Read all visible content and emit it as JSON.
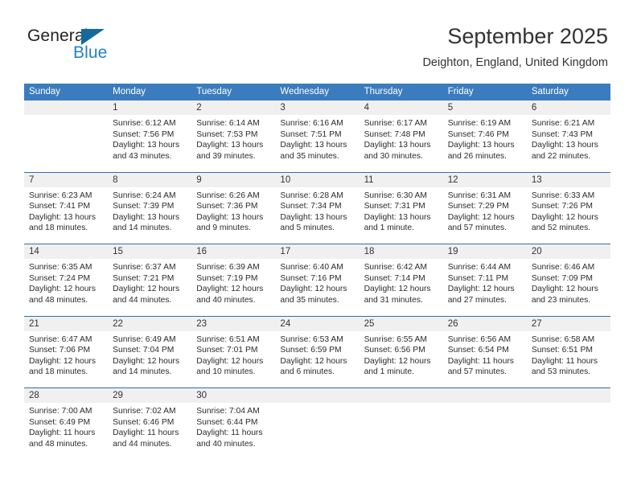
{
  "brand": {
    "line1": "General",
    "line2": "Blue",
    "triangle_color": "#15699e",
    "blue_text_color": "#2481c4"
  },
  "header": {
    "title": "September 2025",
    "subtitle": "Deighton, England, United Kingdom"
  },
  "theme": {
    "header_blue": "#3a7cbe",
    "row_divider_blue": "#2f6fae",
    "date_band_gray": "#f0f0f0"
  },
  "weekdays": [
    "Sunday",
    "Monday",
    "Tuesday",
    "Wednesday",
    "Thursday",
    "Friday",
    "Saturday"
  ],
  "weeks": [
    [
      {
        "day": "",
        "sunrise": "",
        "sunset": "",
        "daylight": "",
        "empty": true
      },
      {
        "day": "1",
        "sunrise": "Sunrise: 6:12 AM",
        "sunset": "Sunset: 7:56 PM",
        "daylight": "Daylight: 13 hours and 43 minutes."
      },
      {
        "day": "2",
        "sunrise": "Sunrise: 6:14 AM",
        "sunset": "Sunset: 7:53 PM",
        "daylight": "Daylight: 13 hours and 39 minutes."
      },
      {
        "day": "3",
        "sunrise": "Sunrise: 6:16 AM",
        "sunset": "Sunset: 7:51 PM",
        "daylight": "Daylight: 13 hours and 35 minutes."
      },
      {
        "day": "4",
        "sunrise": "Sunrise: 6:17 AM",
        "sunset": "Sunset: 7:48 PM",
        "daylight": "Daylight: 13 hours and 30 minutes."
      },
      {
        "day": "5",
        "sunrise": "Sunrise: 6:19 AM",
        "sunset": "Sunset: 7:46 PM",
        "daylight": "Daylight: 13 hours and 26 minutes."
      },
      {
        "day": "6",
        "sunrise": "Sunrise: 6:21 AM",
        "sunset": "Sunset: 7:43 PM",
        "daylight": "Daylight: 13 hours and 22 minutes."
      }
    ],
    [
      {
        "day": "7",
        "sunrise": "Sunrise: 6:23 AM",
        "sunset": "Sunset: 7:41 PM",
        "daylight": "Daylight: 13 hours and 18 minutes."
      },
      {
        "day": "8",
        "sunrise": "Sunrise: 6:24 AM",
        "sunset": "Sunset: 7:39 PM",
        "daylight": "Daylight: 13 hours and 14 minutes."
      },
      {
        "day": "9",
        "sunrise": "Sunrise: 6:26 AM",
        "sunset": "Sunset: 7:36 PM",
        "daylight": "Daylight: 13 hours and 9 minutes."
      },
      {
        "day": "10",
        "sunrise": "Sunrise: 6:28 AM",
        "sunset": "Sunset: 7:34 PM",
        "daylight": "Daylight: 13 hours and 5 minutes."
      },
      {
        "day": "11",
        "sunrise": "Sunrise: 6:30 AM",
        "sunset": "Sunset: 7:31 PM",
        "daylight": "Daylight: 13 hours and 1 minute."
      },
      {
        "day": "12",
        "sunrise": "Sunrise: 6:31 AM",
        "sunset": "Sunset: 7:29 PM",
        "daylight": "Daylight: 12 hours and 57 minutes."
      },
      {
        "day": "13",
        "sunrise": "Sunrise: 6:33 AM",
        "sunset": "Sunset: 7:26 PM",
        "daylight": "Daylight: 12 hours and 52 minutes."
      }
    ],
    [
      {
        "day": "14",
        "sunrise": "Sunrise: 6:35 AM",
        "sunset": "Sunset: 7:24 PM",
        "daylight": "Daylight: 12 hours and 48 minutes."
      },
      {
        "day": "15",
        "sunrise": "Sunrise: 6:37 AM",
        "sunset": "Sunset: 7:21 PM",
        "daylight": "Daylight: 12 hours and 44 minutes."
      },
      {
        "day": "16",
        "sunrise": "Sunrise: 6:39 AM",
        "sunset": "Sunset: 7:19 PM",
        "daylight": "Daylight: 12 hours and 40 minutes."
      },
      {
        "day": "17",
        "sunrise": "Sunrise: 6:40 AM",
        "sunset": "Sunset: 7:16 PM",
        "daylight": "Daylight: 12 hours and 35 minutes."
      },
      {
        "day": "18",
        "sunrise": "Sunrise: 6:42 AM",
        "sunset": "Sunset: 7:14 PM",
        "daylight": "Daylight: 12 hours and 31 minutes."
      },
      {
        "day": "19",
        "sunrise": "Sunrise: 6:44 AM",
        "sunset": "Sunset: 7:11 PM",
        "daylight": "Daylight: 12 hours and 27 minutes."
      },
      {
        "day": "20",
        "sunrise": "Sunrise: 6:46 AM",
        "sunset": "Sunset: 7:09 PM",
        "daylight": "Daylight: 12 hours and 23 minutes."
      }
    ],
    [
      {
        "day": "21",
        "sunrise": "Sunrise: 6:47 AM",
        "sunset": "Sunset: 7:06 PM",
        "daylight": "Daylight: 12 hours and 18 minutes."
      },
      {
        "day": "22",
        "sunrise": "Sunrise: 6:49 AM",
        "sunset": "Sunset: 7:04 PM",
        "daylight": "Daylight: 12 hours and 14 minutes."
      },
      {
        "day": "23",
        "sunrise": "Sunrise: 6:51 AM",
        "sunset": "Sunset: 7:01 PM",
        "daylight": "Daylight: 12 hours and 10 minutes."
      },
      {
        "day": "24",
        "sunrise": "Sunrise: 6:53 AM",
        "sunset": "Sunset: 6:59 PM",
        "daylight": "Daylight: 12 hours and 6 minutes."
      },
      {
        "day": "25",
        "sunrise": "Sunrise: 6:55 AM",
        "sunset": "Sunset: 6:56 PM",
        "daylight": "Daylight: 12 hours and 1 minute."
      },
      {
        "day": "26",
        "sunrise": "Sunrise: 6:56 AM",
        "sunset": "Sunset: 6:54 PM",
        "daylight": "Daylight: 11 hours and 57 minutes."
      },
      {
        "day": "27",
        "sunrise": "Sunrise: 6:58 AM",
        "sunset": "Sunset: 6:51 PM",
        "daylight": "Daylight: 11 hours and 53 minutes."
      }
    ],
    [
      {
        "day": "28",
        "sunrise": "Sunrise: 7:00 AM",
        "sunset": "Sunset: 6:49 PM",
        "daylight": "Daylight: 11 hours and 48 minutes."
      },
      {
        "day": "29",
        "sunrise": "Sunrise: 7:02 AM",
        "sunset": "Sunset: 6:46 PM",
        "daylight": "Daylight: 11 hours and 44 minutes."
      },
      {
        "day": "30",
        "sunrise": "Sunrise: 7:04 AM",
        "sunset": "Sunset: 6:44 PM",
        "daylight": "Daylight: 11 hours and 40 minutes."
      },
      {
        "day": "",
        "sunrise": "",
        "sunset": "",
        "daylight": "",
        "empty": true
      },
      {
        "day": "",
        "sunrise": "",
        "sunset": "",
        "daylight": "",
        "empty": true
      },
      {
        "day": "",
        "sunrise": "",
        "sunset": "",
        "daylight": "",
        "empty": true
      },
      {
        "day": "",
        "sunrise": "",
        "sunset": "",
        "daylight": "",
        "empty": true
      }
    ]
  ]
}
